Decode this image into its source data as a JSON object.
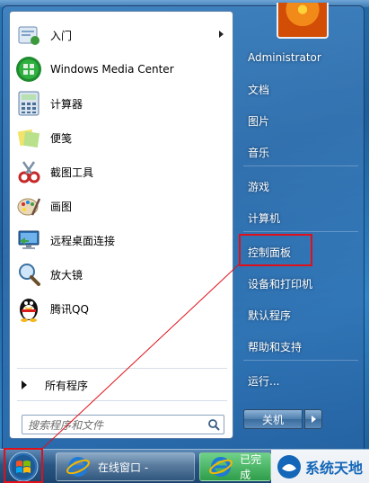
{
  "programs": [
    {
      "label": "入门",
      "icon": "getting-started-icon",
      "has_submenu": true
    },
    {
      "label": "Windows Media Center",
      "icon": "media-center-icon",
      "has_submenu": false
    },
    {
      "label": "计算器",
      "icon": "calculator-icon",
      "has_submenu": false
    },
    {
      "label": "便笺",
      "icon": "sticky-notes-icon",
      "has_submenu": false
    },
    {
      "label": "截图工具",
      "icon": "snipping-tool-icon",
      "has_submenu": false
    },
    {
      "label": "画图",
      "icon": "paint-icon",
      "has_submenu": false
    },
    {
      "label": "远程桌面连接",
      "icon": "remote-desktop-icon",
      "has_submenu": false
    },
    {
      "label": "放大镜",
      "icon": "magnifier-icon",
      "has_submenu": false
    },
    {
      "label": "腾讯QQ",
      "icon": "qq-penguin-icon",
      "has_submenu": false
    }
  ],
  "all_programs": "所有程序",
  "search_placeholder": "搜索程序和文件",
  "right_pane": [
    "Administrator",
    "文档",
    "图片",
    "音乐",
    "游戏",
    "计算机",
    "控制面板",
    "设备和打印机",
    "默认程序",
    "帮助和支持",
    "运行..."
  ],
  "shutdown_label": "关机",
  "taskbar": {
    "task1_label": "在线窗口 -",
    "task2_label": "已完成"
  },
  "watermark_text": "系统天地",
  "highlight_color": "#e0101a"
}
